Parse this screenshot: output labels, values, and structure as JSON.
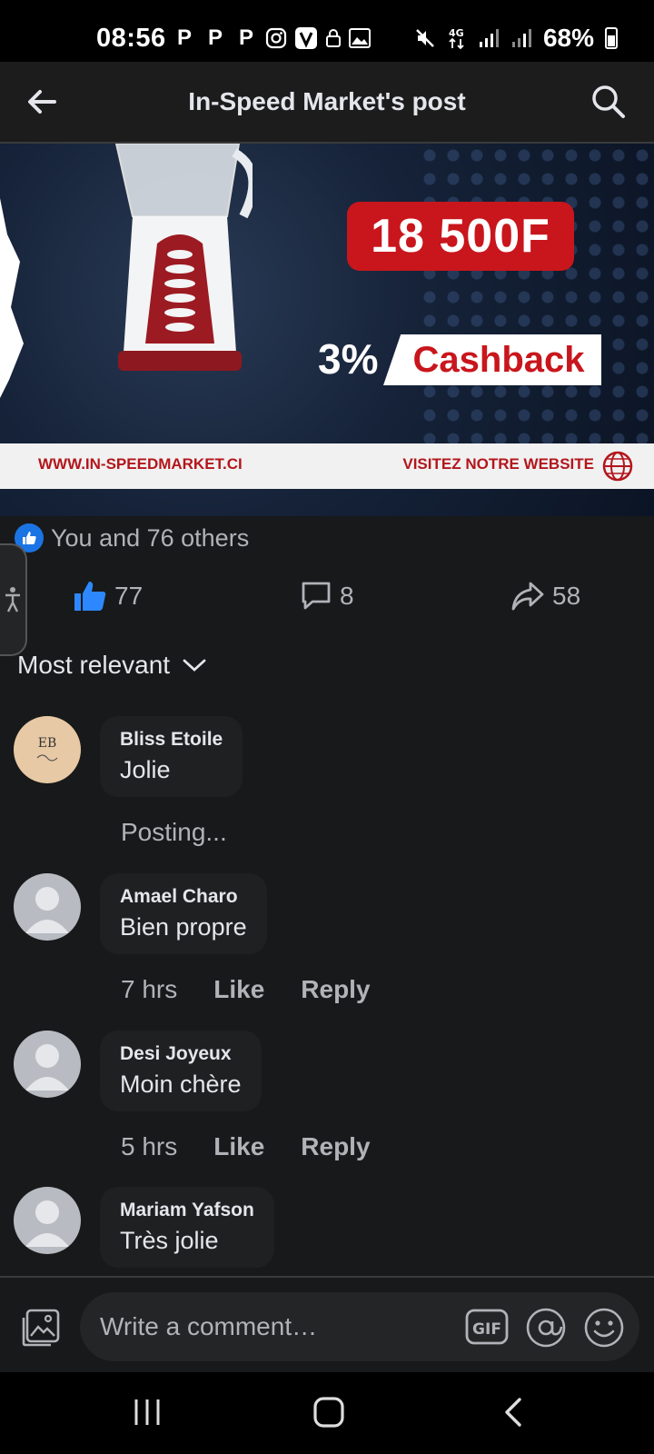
{
  "status_bar": {
    "time": "08:56",
    "notification_icons": [
      "P",
      "P",
      "P"
    ],
    "battery": "68%"
  },
  "header": {
    "title": "In-Speed Market's post"
  },
  "banner": {
    "price": "18 500F",
    "cashback_percent": "3%",
    "cashback_label": "Cashback",
    "website": "WWW.IN-SPEEDMARKET.CI",
    "visit_label": "VISITEZ NOTRE WEBSITE"
  },
  "reactions": {
    "summary": "You and 76 others",
    "like_count": "77",
    "comment_count": "8",
    "share_count": "58"
  },
  "sort": {
    "label": "Most relevant"
  },
  "comments": [
    {
      "name": "Bliss Etoile",
      "text": "Jolie",
      "status": "Posting...",
      "avatar": "EB"
    },
    {
      "name": "Amael Charo",
      "text": "Bien propre",
      "time": "7 hrs",
      "like": "Like",
      "reply": "Reply"
    },
    {
      "name": "Desi Joyeux",
      "text": "Moin chère",
      "time": "5 hrs",
      "like": "Like",
      "reply": "Reply"
    },
    {
      "name": "Mariam Yafson",
      "text": "Très jolie"
    }
  ],
  "composer": {
    "placeholder": "Write a comment…",
    "gif_label": "GIF"
  },
  "colors": {
    "accent": "#1b74e4",
    "background": "#18191a",
    "brand_red": "#c8161c"
  }
}
